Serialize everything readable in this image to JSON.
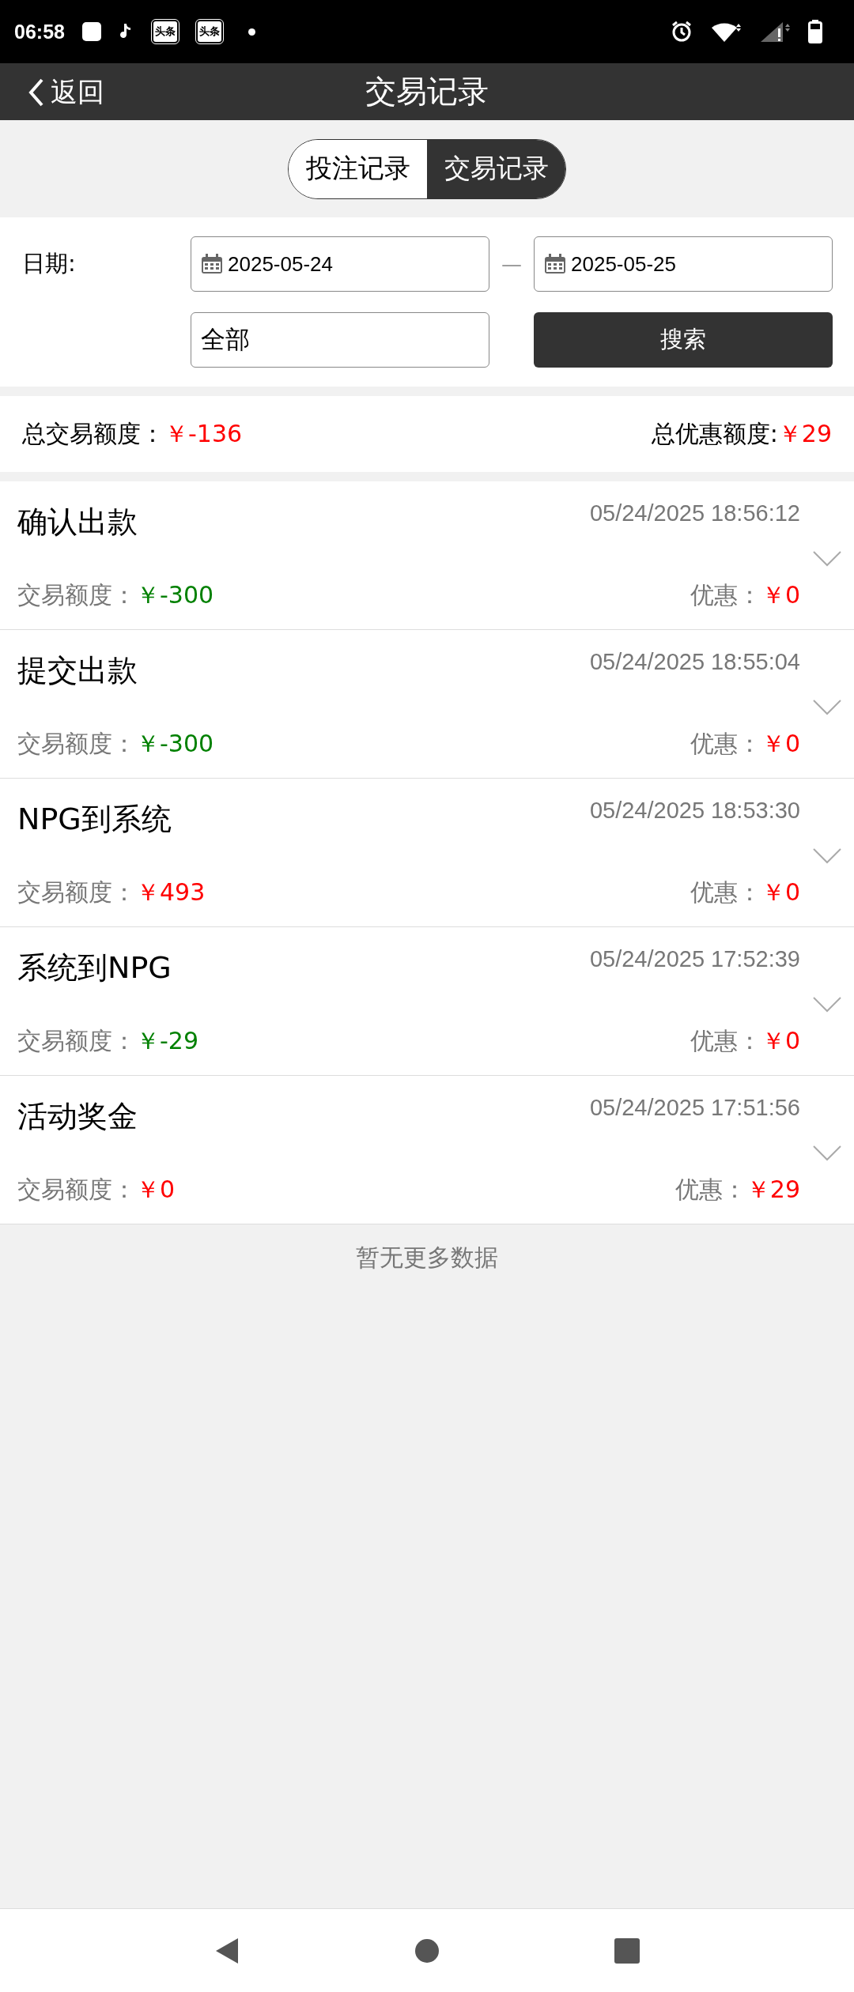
{
  "status_bar": {
    "time": "06:58",
    "app_badges": [
      "头条",
      "头条"
    ]
  },
  "header": {
    "back": "返回",
    "title": "交易记录"
  },
  "tabs": [
    {
      "label": "投注记录",
      "selected": false
    },
    {
      "label": "交易记录",
      "selected": true
    }
  ],
  "filter": {
    "date_label": "日期:",
    "start_date": "2025-05-24",
    "separator": "—",
    "end_date": "2025-05-25",
    "type_value": "全部",
    "search_button": "搜索"
  },
  "totals": {
    "amount_label": "总交易额度：",
    "amount": "￥-136",
    "discount_label": "总优惠额度:",
    "discount": "￥29"
  },
  "records": [
    {
      "title": "确认出款",
      "time": "05/24/2025 18:56:12",
      "amount_label": "交易额度：",
      "amount": "￥-300",
      "color": "#008000",
      "discount_label": "优惠：",
      "discount": "￥0"
    },
    {
      "title": "提交出款",
      "time": "05/24/2025 18:55:04",
      "amount_label": "交易额度：",
      "amount": "￥-300",
      "color": "#008000",
      "discount_label": "优惠：",
      "discount": "￥0"
    },
    {
      "title": "NPG到系统",
      "time": "05/24/2025 18:53:30",
      "amount_label": "交易额度：",
      "amount": "￥493",
      "color": "#ff0000",
      "discount_label": "优惠：",
      "discount": "￥0"
    },
    {
      "title": "系统到NPG",
      "time": "05/24/2025 17:52:39",
      "amount_label": "交易额度：",
      "amount": "￥-29",
      "color": "#008000",
      "discount_label": "优惠：",
      "discount": "￥0"
    },
    {
      "title": "活动奖金",
      "time": "05/24/2025 17:51:56",
      "amount_label": "交易额度：",
      "amount": "￥0",
      "color": "#ff0000",
      "discount_label": "优惠：",
      "discount": "￥29"
    }
  ],
  "footer_note": "暂无更多数据"
}
